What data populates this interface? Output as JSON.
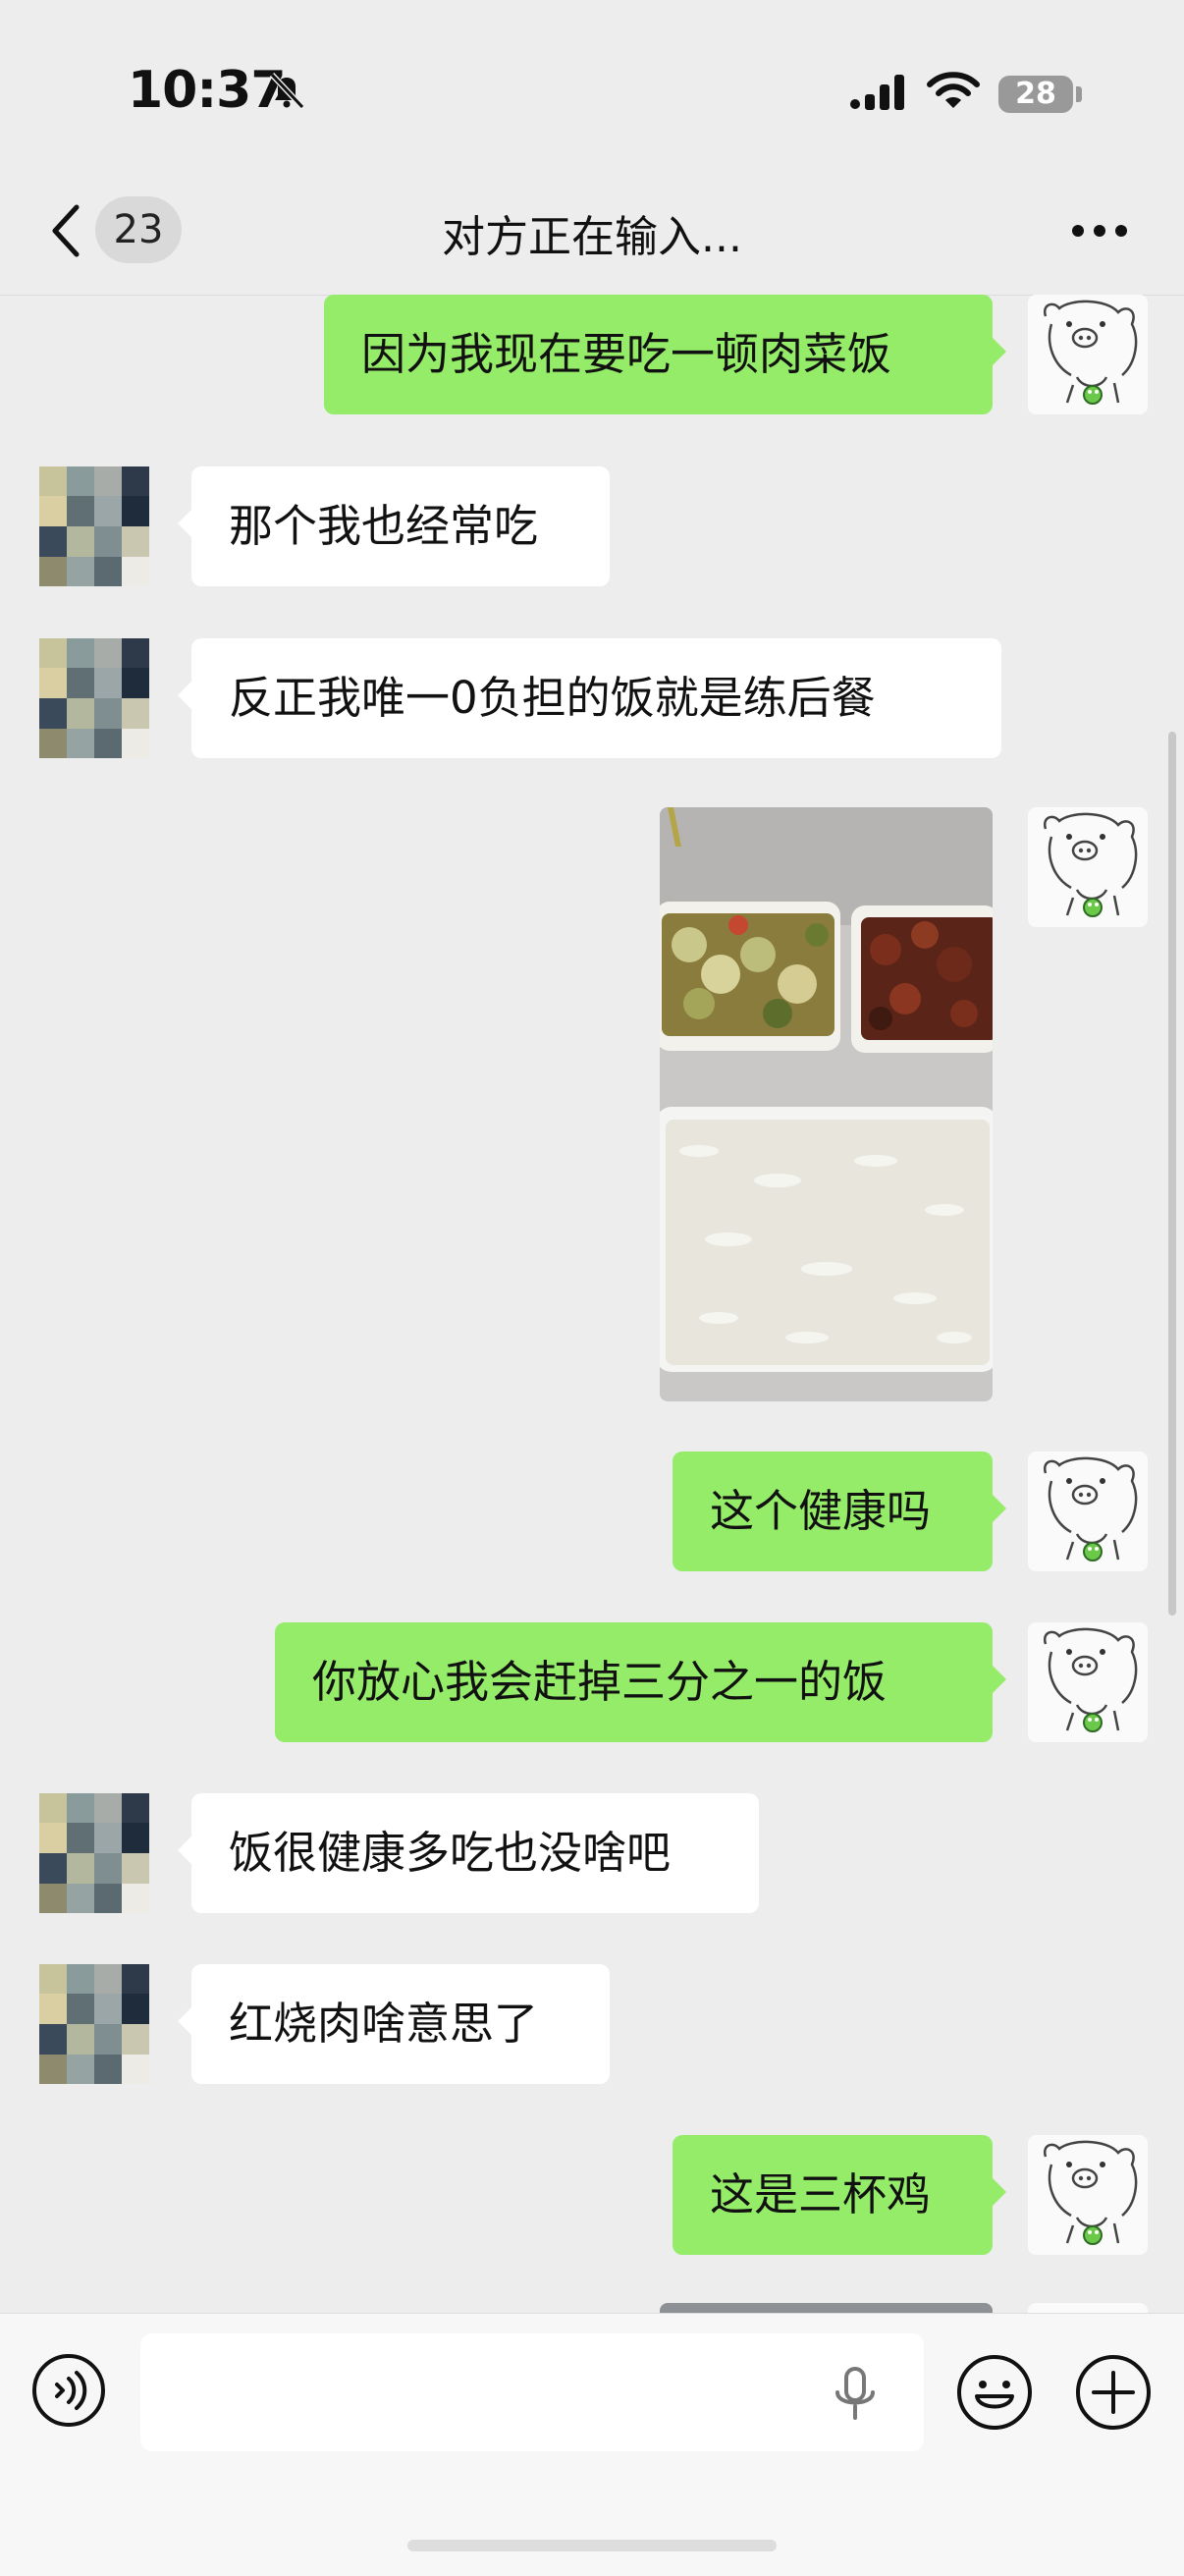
{
  "status_bar": {
    "time": "10:37",
    "battery": "28",
    "icons": [
      "bell-slash-icon",
      "cellular-signal-icon",
      "wifi-icon",
      "battery-icon"
    ]
  },
  "nav": {
    "unread_count": "23",
    "title": "对方正在输入...",
    "icons": [
      "chevron-left-icon",
      "more-icon"
    ]
  },
  "messages": [
    {
      "side": "out",
      "text": "因为我现在要吃一顿肉菜饭"
    },
    {
      "side": "in",
      "text": "那个我也经常吃"
    },
    {
      "side": "in",
      "text": "反正我唯一0负担的饭就是练后餐"
    },
    {
      "side": "out",
      "type": "image"
    },
    {
      "side": "out",
      "text": "这个健康吗"
    },
    {
      "side": "out",
      "text": "你放心我会赶掉三分之一的饭"
    },
    {
      "side": "in",
      "text": "饭很健康多吃也没啥吧"
    },
    {
      "side": "in",
      "text": "红烧肉啥意思了"
    },
    {
      "side": "out",
      "text": "这是三杯鸡"
    }
  ],
  "input_bar": {
    "icons": [
      "voice-input-icon",
      "microphone-icon",
      "emoji-icon",
      "plus-icon"
    ]
  },
  "colors": {
    "background": "#ededed",
    "outgoing_bubble": "#95ec69",
    "incoming_bubble": "#ffffff"
  }
}
